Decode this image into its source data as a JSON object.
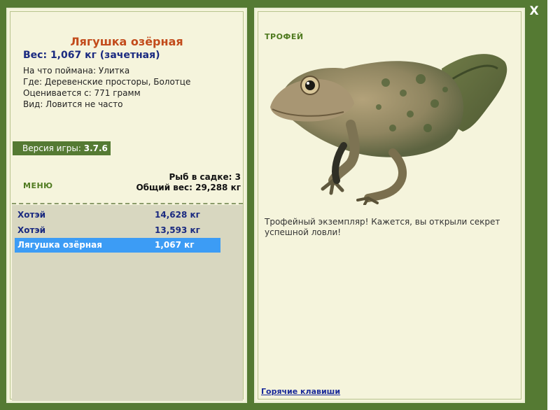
{
  "window": {
    "close_label": "X"
  },
  "fish": {
    "title": "Лягушка озёрная",
    "weight": "Вес: 1,067 кг (зачетная)",
    "caught_on": "На что поймана: Улитка",
    "location": "Где: Деревенские просторы, Болотце",
    "rated_from": "Оценивается с: 771 грамм",
    "kind": "Вид: Ловится не часто"
  },
  "version": {
    "label": "Версия игры:",
    "value": "3.7.6"
  },
  "menu": {
    "label": "МЕНЮ"
  },
  "catch": {
    "fish_count": "Рыб в садке: 3",
    "total_weight": "Общий вес: 29,288 кг"
  },
  "catch_list": [
    {
      "name": "Хотэй",
      "weight": "14,628 кг",
      "selected": false
    },
    {
      "name": "Хотэй",
      "weight": "13,593 кг",
      "selected": false
    },
    {
      "name": "Лягушка озёрная",
      "weight": "1,067 кг",
      "selected": true
    }
  ],
  "trophy": {
    "label": "ТРОФЕЙ",
    "description": "Трофейный экземпляр! Кажется, вы открыли секрет успешной ловли!",
    "image_icon": "frog-image"
  },
  "hotkeys": {
    "label": "Горячие клавиши"
  },
  "colors": {
    "frame": "#557a33",
    "panel": "#f5f4dc",
    "selected_row": "#3c9cf5",
    "title": "#c24b1b",
    "weight_text": "#1a2a80"
  }
}
